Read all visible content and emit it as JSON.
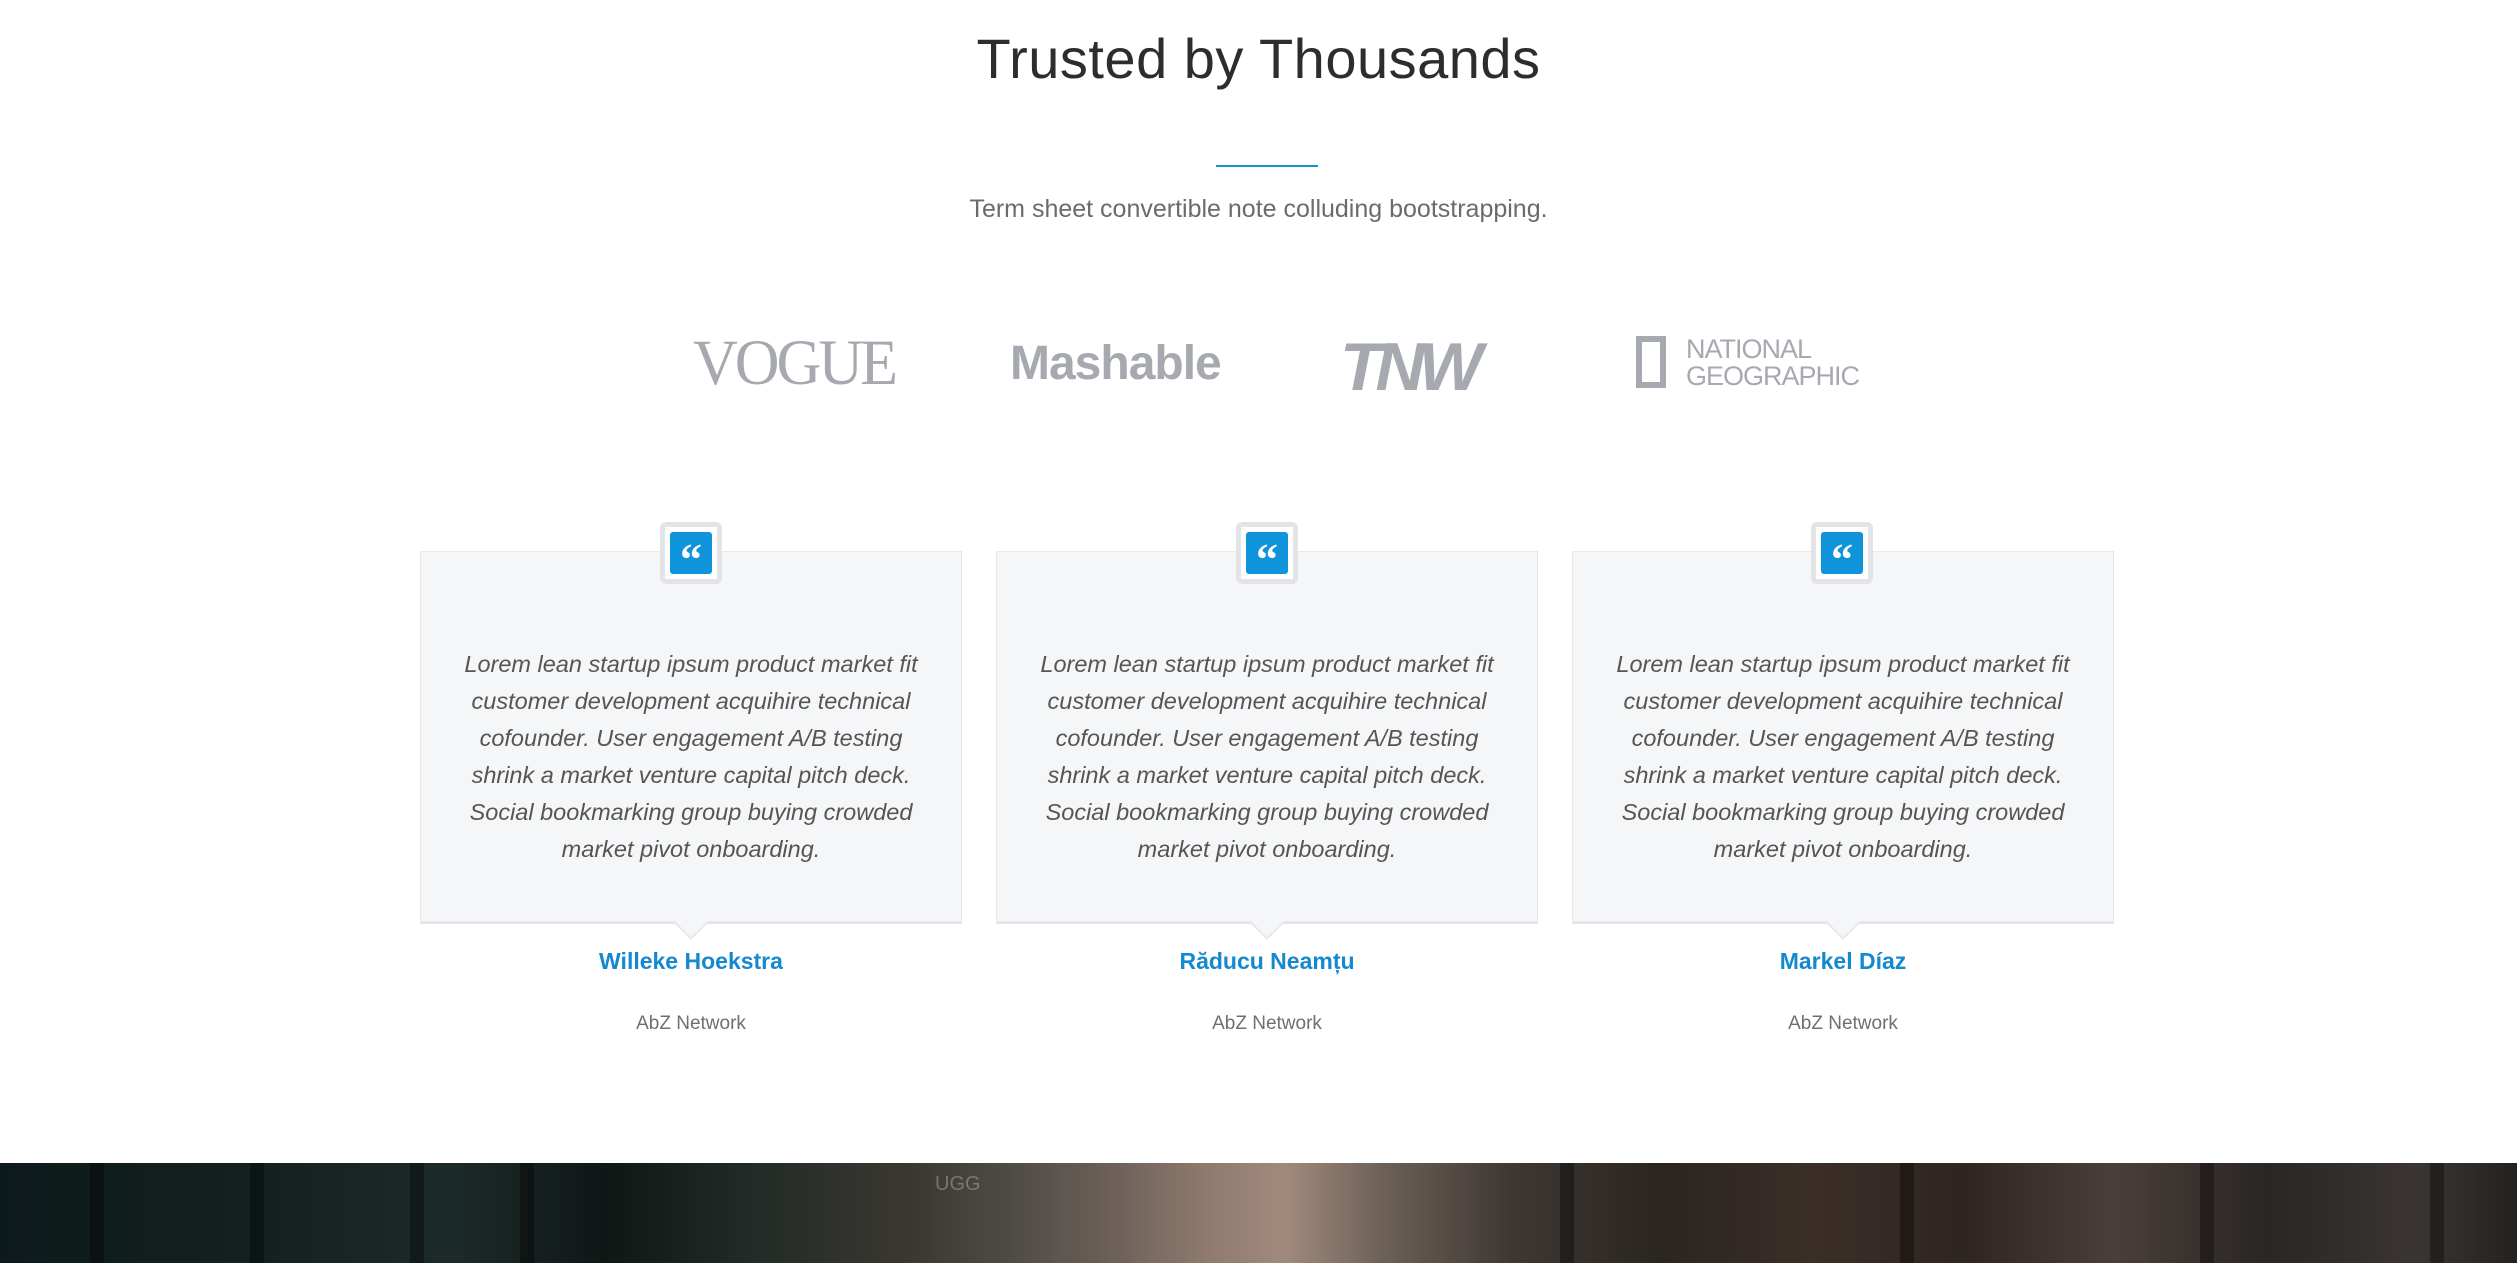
{
  "section": {
    "title": "Trusted by Thousands",
    "subtitle": "Term sheet convertible note colluding bootstrapping.",
    "accent_color": "#1a8ed6"
  },
  "logos": {
    "vogue": "VOGUE",
    "mashable": "Mashable",
    "tnw": "TNW",
    "natgeo_line1": "NATIONAL",
    "natgeo_line2": "GEOGRAPHIC"
  },
  "testimonials": [
    {
      "icon": "quote-icon",
      "quote": "Lorem lean startup ipsum product market fit customer development acquihire technical cofounder. User engagement A/B testing shrink a market venture capital pitch deck. Social bookmarking group buying crowded market pivot onboarding.",
      "name": "Willeke Hoekstra",
      "company": "AbZ Network"
    },
    {
      "icon": "quote-icon",
      "quote": "Lorem lean startup ipsum product market fit customer development acquihire technical cofounder. User engagement A/B testing shrink a market venture capital pitch deck. Social bookmarking group buying crowded market pivot onboarding.",
      "name": "Răducu Neamțu",
      "company": "AbZ Network"
    },
    {
      "icon": "quote-icon",
      "quote": "Lorem lean startup ipsum product market fit customer development acquihire technical cofounder. User engagement A/B testing shrink a market venture capital pitch deck. Social bookmarking group buying crowded market pivot onboarding.",
      "name": "Markel Díaz",
      "company": "AbZ Network"
    }
  ],
  "colors": {
    "name_color": "#1589cf",
    "badge_color": "#0f93da",
    "card_background": "#f5f6f8"
  },
  "footer_photo": {
    "sign_text": "UGG"
  }
}
